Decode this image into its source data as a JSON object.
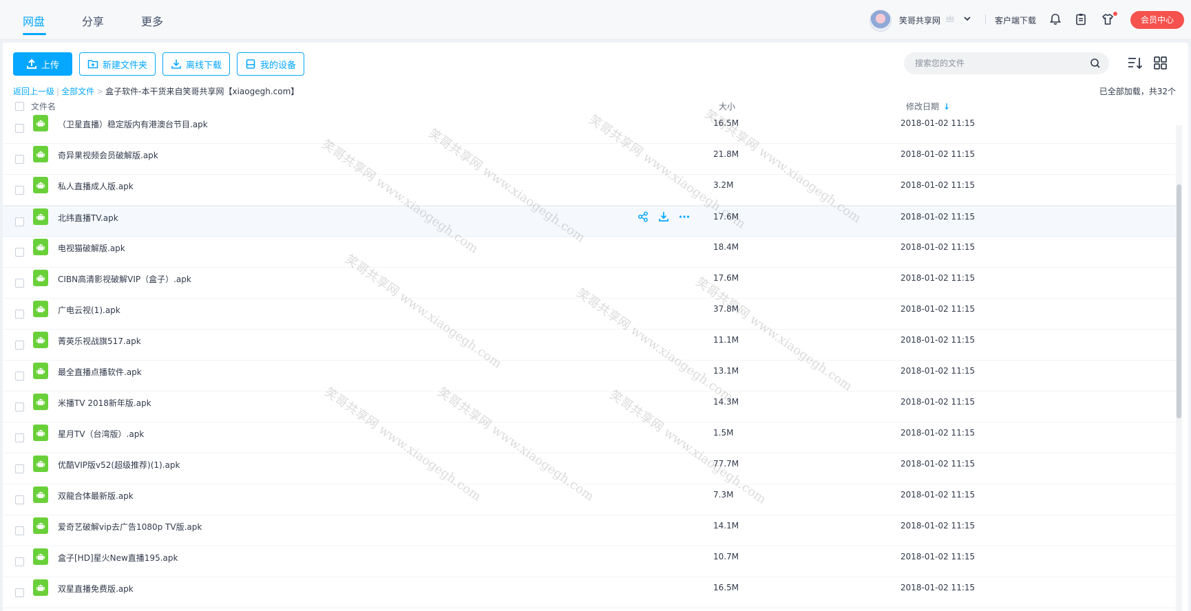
{
  "nav": {
    "tabs": [
      {
        "label": "网盘",
        "active": true
      },
      {
        "label": "分享",
        "active": false
      },
      {
        "label": "更多",
        "active": false
      }
    ],
    "user_name": "笑哥共享网",
    "client_download": "客户端下载",
    "vip_center": "会员中心",
    "accent_color": "#06a7ff",
    "vip_color": "#f5524d"
  },
  "toolbar": {
    "upload": "上传",
    "new_folder": "新建文件夹",
    "offline_download": "离线下载",
    "my_devices": "我的设备",
    "search_placeholder": "搜索您的文件"
  },
  "breadcrumb": {
    "back": "返回上一级",
    "all_files": "全部文件",
    "separator": ">",
    "current": "盒子软件-本干货来自笑哥共享网【xiaogegh.com】"
  },
  "load_status": "已全部加载，共32个",
  "table": {
    "columns": {
      "name": "文件名",
      "size": "大小",
      "date": "修改日期"
    },
    "rows": [
      {
        "name": "（卫星直播）稳定版内有港澳台节目.apk",
        "size": "16.5M",
        "date": "2018-01-02 11:15"
      },
      {
        "name": "奇异果视频会员破解版.apk",
        "size": "21.8M",
        "date": "2018-01-02 11:15"
      },
      {
        "name": "私人直播成人版.apk",
        "size": "3.2M",
        "date": "2018-01-02 11:15"
      },
      {
        "name": "北纬直播TV.apk",
        "size": "17.6M",
        "date": "2018-01-02 11:15",
        "hover": true
      },
      {
        "name": "电视猫破解版.apk",
        "size": "18.4M",
        "date": "2018-01-02 11:15"
      },
      {
        "name": "CIBN高清影视破解VIP（盒子）.apk",
        "size": "17.6M",
        "date": "2018-01-02 11:15"
      },
      {
        "name": "广电云视(1).apk",
        "size": "37.8M",
        "date": "2018-01-02 11:15"
      },
      {
        "name": "菁英乐视战旗517.apk",
        "size": "11.1M",
        "date": "2018-01-02 11:15"
      },
      {
        "name": "最全直播点播软件.apk",
        "size": "13.1M",
        "date": "2018-01-02 11:15"
      },
      {
        "name": "米播TV 2018新年版.apk",
        "size": "14.3M",
        "date": "2018-01-02 11:15"
      },
      {
        "name": "星月TV（台湾版）.apk",
        "size": "1.5M",
        "date": "2018-01-02 11:15"
      },
      {
        "name": "优酷VIP版v52(超级推荐)(1).apk",
        "size": "77.7M",
        "date": "2018-01-02 11:15"
      },
      {
        "name": "双龍合体最新版.apk",
        "size": "7.3M",
        "date": "2018-01-02 11:15"
      },
      {
        "name": "爱奇艺破解vip去广告1080p TV版.apk",
        "size": "14.1M",
        "date": "2018-01-02 11:15"
      },
      {
        "name": "盒子[HD]星火New直播195.apk",
        "size": "10.7M",
        "date": "2018-01-02 11:15"
      },
      {
        "name": "双星直播免费版.apk",
        "size": "16.5M",
        "date": "2018-01-02 11:15"
      }
    ]
  },
  "watermark": "笑哥共享网 www.xiaogegh.com"
}
